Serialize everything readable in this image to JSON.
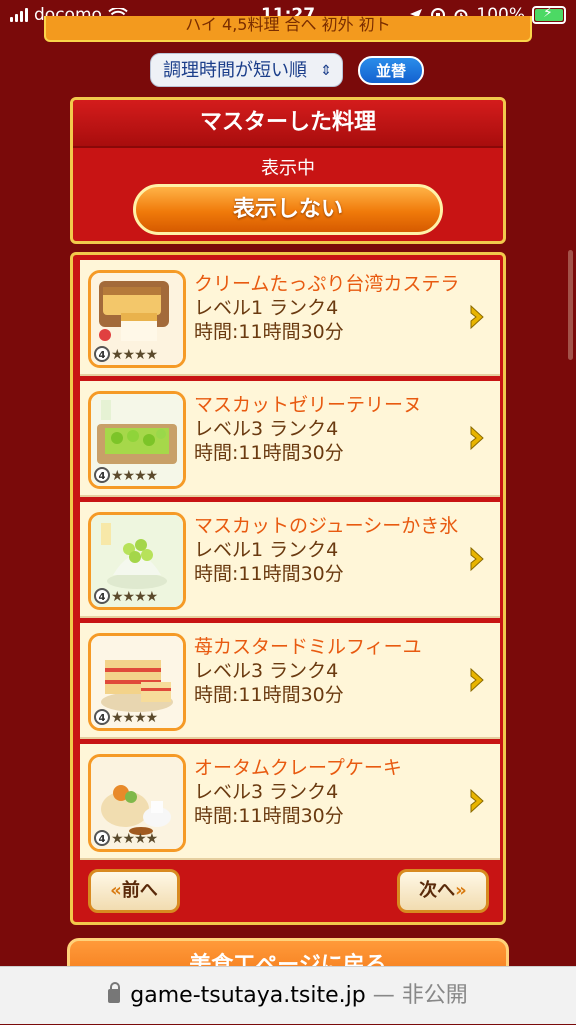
{
  "status_bar": {
    "carrier": "docomo",
    "time": "11:27",
    "battery": "100%"
  },
  "top_banner": {
    "text": "ハイ 4,5料理 合へ 初外 初ト"
  },
  "sort": {
    "selected": "調理時間が短い順",
    "button_label": "並替"
  },
  "master_panel": {
    "title": "マスターした料理",
    "state": "表示中",
    "toggle_label": "表示しない"
  },
  "dishes": [
    {
      "name": "クリームたっぷり台湾カステラ",
      "level": "レベル1 ランク4",
      "time": "時間:11時間30分",
      "rank": "4",
      "stars": "★★★★"
    },
    {
      "name": "マスカットゼリーテリーヌ",
      "level": "レベル3 ランク4",
      "time": "時間:11時間30分",
      "rank": "4",
      "stars": "★★★★"
    },
    {
      "name": "マスカットのジューシーかき氷",
      "level": "レベル1 ランク4",
      "time": "時間:11時間30分",
      "rank": "4",
      "stars": "★★★★"
    },
    {
      "name": "苺カスタードミルフィーユ",
      "level": "レベル3 ランク4",
      "time": "時間:11時間30分",
      "rank": "4",
      "stars": "★★★★"
    },
    {
      "name": "オータムクレープケーキ",
      "level": "レベル3 ランク4",
      "time": "時間:11時間30分",
      "rank": "4",
      "stars": "★★★★"
    }
  ],
  "pagination": {
    "prev_label": "前へ",
    "next_label": "次へ"
  },
  "back_button": {
    "label": "美食工ページに戻る"
  },
  "url_bar": {
    "domain": "game-tsutaya.tsite.jp",
    "suffix": "— 非公開"
  },
  "icons": {
    "row_arrow": "chevron-right-icon",
    "lock": "lock-icon"
  },
  "colors": {
    "background": "#7a0a0a",
    "panel": "#c81414",
    "accent": "#f07a0a",
    "gold": "#f2c94c"
  }
}
